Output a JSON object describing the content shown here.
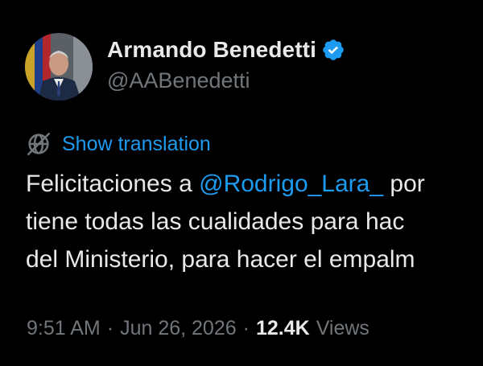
{
  "author": {
    "display_name": "Armando Benedetti",
    "handle": "@AABenedetti",
    "verified_color": "#1d9bf0"
  },
  "translation": {
    "label": "Show translation",
    "icon": "globe-slash-icon"
  },
  "tweet": {
    "line1_prefix": "Felicitaciones a ",
    "line1_mention": "@Rodrigo_Lara_",
    "line1_suffix": " por",
    "line2": "tiene todas las cualidades para hac",
    "line3": "del Ministerio, para hacer el empalm"
  },
  "meta": {
    "time": "9:51 AM",
    "separator": "·",
    "date": "Jun 26, 2026",
    "views_count": "12.4K",
    "views_label": "Views"
  },
  "colors": {
    "background": "#000000",
    "primary_text": "#e7e9ea",
    "secondary_text": "#71767b",
    "accent": "#1d9bf0"
  }
}
